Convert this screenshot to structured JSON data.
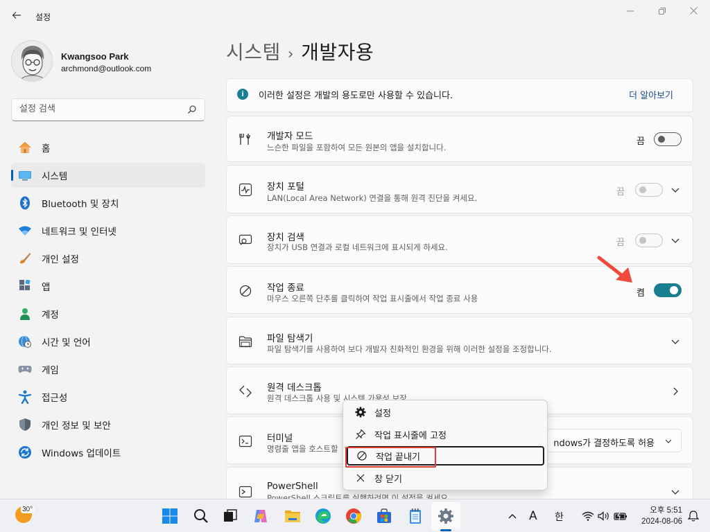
{
  "window": {
    "title": "설정"
  },
  "user": {
    "name": "Kwangsoo Park",
    "email": "archmond@outlook.com"
  },
  "search": {
    "placeholder": "설정 검색"
  },
  "sidebar": {
    "items": [
      {
        "label": "홈"
      },
      {
        "label": "시스템"
      },
      {
        "label": "Bluetooth 및 장치"
      },
      {
        "label": "네트워크 및 인터넷"
      },
      {
        "label": "개인 설정"
      },
      {
        "label": "앱"
      },
      {
        "label": "계정"
      },
      {
        "label": "시간 및 언어"
      },
      {
        "label": "게임"
      },
      {
        "label": "접근성"
      },
      {
        "label": "개인 정보 및 보안"
      },
      {
        "label": "Windows 업데이트"
      }
    ]
  },
  "breadcrumb": {
    "parent": "시스템",
    "separator": "›",
    "current": "개발자용"
  },
  "info": {
    "text": "이러한 설정은 개발의 용도로만 사용할 수 있습니다.",
    "link": "더 알아보기"
  },
  "settings": {
    "dev_mode": {
      "title": "개발자 모드",
      "desc": "느슨한 파일을 포함하여 모든 원본의 앱을 설치합니다.",
      "state": "끔"
    },
    "device_portal": {
      "title": "장치 포털",
      "desc": "LAN(Local Area Network) 연결을 통해 원격 진단을 켜세요.",
      "state": "끔"
    },
    "device_discovery": {
      "title": "장치 검색",
      "desc": "장치가 USB 연결과 로컬 네트워크에 표시되게 하세요.",
      "state": "끔"
    },
    "end_task": {
      "title": "작업 종료",
      "desc": "마우스 오른쪽 단추를 클릭하여 작업 표시줄에서 작업 종료 사용",
      "state": "켬"
    },
    "file_explorer": {
      "title": "파일 탐색기",
      "desc": "파일 탐색기를 사용하여 보다 개발자 친화적인 환경을 위해 이러한 설정을 조정합니다."
    },
    "remote_desktop": {
      "title": "원격 데스크톱",
      "desc": "원격 데스크톱 사용 및 시스템 가용성 보장"
    },
    "terminal": {
      "title": "터미널",
      "desc": "명령줄 앱을 호스트할",
      "value": "ndows가 결정하도록 허용"
    },
    "powershell": {
      "title": "PowerShell",
      "desc": "PowerShell 스크립트를 실행하려면 이 설정을 켜세요."
    }
  },
  "context_menu": {
    "items": [
      {
        "label": "설정",
        "icon": "gear-icon"
      },
      {
        "label": "작업 표시줄에 고정",
        "icon": "pin-icon"
      },
      {
        "label": "작업 끝내기",
        "icon": "prohibit-icon"
      },
      {
        "label": "창 닫기",
        "icon": "close-icon"
      }
    ]
  },
  "taskbar": {
    "weather_temp": "30°",
    "ime_a": "A",
    "ime_lang": "한",
    "time": "오후 5:51",
    "date": "2024-08-06"
  },
  "colors": {
    "accent": "#1a7e92",
    "highlight": "#e53935",
    "nav_accent": "#005fb8"
  }
}
